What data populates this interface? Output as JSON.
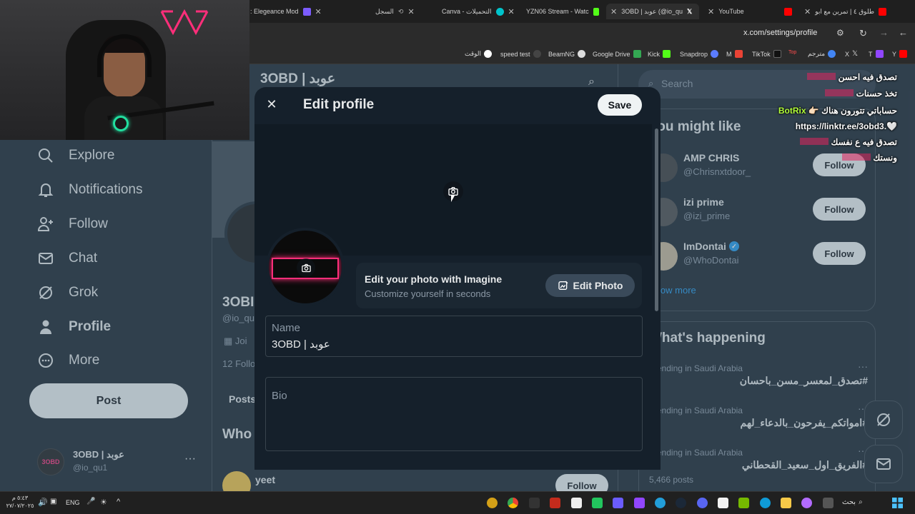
{
  "browser": {
    "tabs": [
      {
        "label": ": Elegeance Mod",
        "color": "#7c5cff"
      },
      {
        "label": "السجل",
        "color": "#9aa0a6"
      },
      {
        "label": "Canva - التحميلات",
        "color": "#00c4cc"
      },
      {
        "label": "YZN06 Stream - Watc",
        "color": "#53fc18"
      },
      {
        "label": "3OBD | عوبد (@io_qu",
        "color": "#ffffff"
      },
      {
        "label": "YouTube",
        "color": "#ff0000"
      },
      {
        "label": "طلوق ٤ | تمرين مع ابو",
        "color": "#ff0000"
      }
    ],
    "url": "x.com/settings/profile",
    "bookmarks": [
      "الوقت",
      "speed test",
      "BeamNG",
      "Google Drive",
      "Kick",
      "Snapdrop",
      "M",
      "TikTok",
      "Top",
      "مترجم",
      "X",
      "T",
      "Y"
    ]
  },
  "header": {
    "title": "3OBD | عوبد"
  },
  "sidebar": {
    "items": [
      {
        "label": "Explore"
      },
      {
        "label": "Notifications"
      },
      {
        "label": "Follow"
      },
      {
        "label": "Chat"
      },
      {
        "label": "Grok"
      },
      {
        "label": "Profile"
      },
      {
        "label": "More"
      }
    ],
    "post_label": "Post",
    "account_name": "3OBD | عوبد",
    "account_handle": "@io_qu1"
  },
  "profile_bg": {
    "name_partial": "3OBI",
    "handle_partial": "@io_qu",
    "joined_partial": "Joi",
    "following_partial": "12 Follo",
    "tab_posts": "Posts",
    "who_partial": "Who",
    "suggest_name": "yeet",
    "suggest_follow": "Follow"
  },
  "modal": {
    "title": "Edit profile",
    "save_label": "Save",
    "imagine_title": "Edit your photo with Imagine",
    "imagine_subtitle": "Customize yourself in seconds",
    "edit_photo_label": "Edit Photo",
    "name_label": "Name",
    "name_value": "3OBD | عوبد",
    "bio_label": "Bio"
  },
  "right_col": {
    "search_placeholder": "Search",
    "you_might_like": "You might like",
    "suggestions": [
      {
        "name": "AMP CHRIS",
        "handle": "@Chrisnxtdoor_",
        "follow": "Follow"
      },
      {
        "name": "izi prime",
        "handle": "@izi_prime",
        "follow": "Follow"
      },
      {
        "name": "ImDontai",
        "handle": "@WhoDontai",
        "follow": "Follow"
      }
    ],
    "show_more": "Show more",
    "whats_happening": "What's happening",
    "trends": [
      {
        "context": "Trending in Saudi Arabia",
        "tag": "#تصدق_لمعسر_مسن_باحسان"
      },
      {
        "context": "Trending in Saudi Arabia",
        "tag": "#امواتكم_يفرحون_بالدعاء_لهم"
      },
      {
        "context": "Trending in Saudi Arabia",
        "tag": "#الفريق_اول_سعيد_القحطاني"
      }
    ],
    "posts_count": "5,466 posts"
  },
  "chat": [
    {
      "user": "",
      "msg": "تصدق فيه احسن"
    },
    {
      "user": "",
      "msg": "تخذ حسنات"
    },
    {
      "user": "BotRix",
      "msg": "حساباتي تتورون هناك 👉🏻"
    },
    {
      "user": "",
      "msg": "https://linktr.ee/3obd3.🤍"
    },
    {
      "user": "",
      "msg": "تصدق فيه ع نفسك"
    },
    {
      "user": "",
      "msg": "ونستك"
    }
  ],
  "taskbar": {
    "time": "٥:٤٣ م",
    "date": "٢٧/٠٧/٢٠٢٥",
    "lang": "ENG",
    "search_label": "بحث"
  },
  "colors": {
    "accent": "#1d9bf0",
    "page_bg": "#15202b",
    "brand_pink": "#ff2e7a"
  }
}
